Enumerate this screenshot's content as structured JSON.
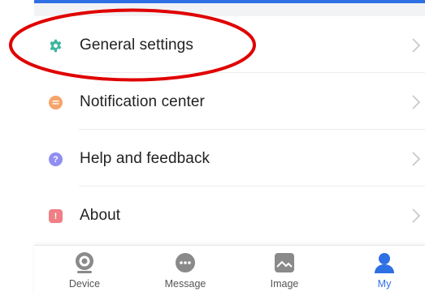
{
  "menu": {
    "items": [
      {
        "label": "General settings",
        "icon": "gear-icon"
      },
      {
        "label": "Notification center",
        "icon": "notification-icon"
      },
      {
        "label": "Help and feedback",
        "icon": "help-icon",
        "glyph": "?"
      },
      {
        "label": "About",
        "icon": "info-icon",
        "glyph": "!"
      }
    ]
  },
  "tabbar": {
    "tabs": [
      {
        "label": "Device",
        "icon": "camera-icon"
      },
      {
        "label": "Message",
        "icon": "message-icon"
      },
      {
        "label": "Image",
        "icon": "image-icon"
      },
      {
        "label": "My",
        "icon": "person-icon",
        "active": true
      }
    ]
  },
  "colors": {
    "accent": "#2f6fe4",
    "highlight_ring": "#e00000",
    "gear": "#3fb7a0",
    "notification": "#f5a46b",
    "help": "#8f8ef2",
    "about": "#ef7f85"
  }
}
